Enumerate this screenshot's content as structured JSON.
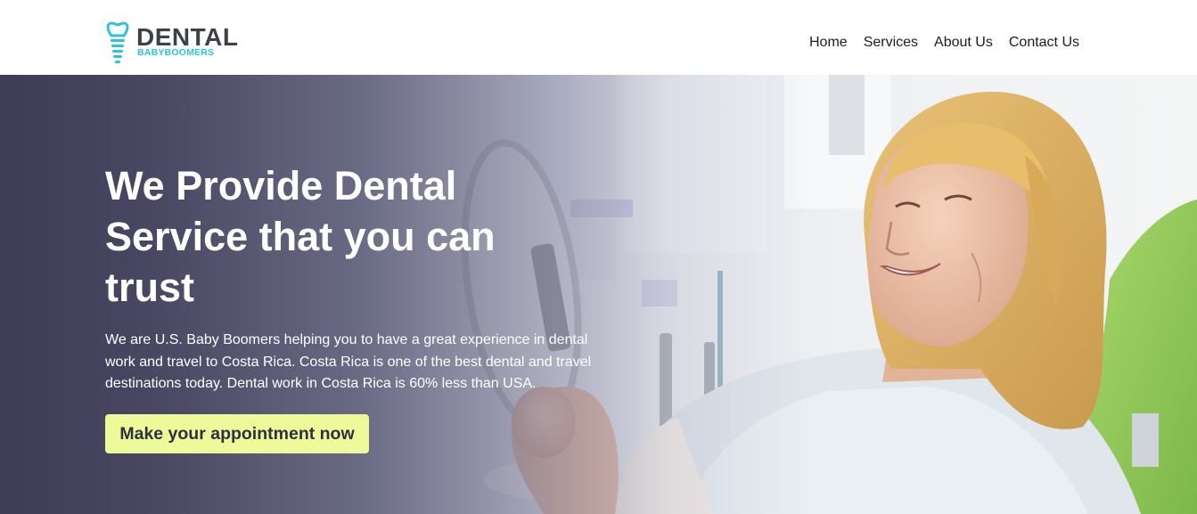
{
  "brand": {
    "name": "DENTAL",
    "subname": "BABYBOOMERS",
    "colors": {
      "dark": "#3e4247",
      "accent": "#2cc3dc"
    }
  },
  "nav": {
    "items": [
      {
        "label": "Home"
      },
      {
        "label": "Services"
      },
      {
        "label": "About Us"
      },
      {
        "label": "Contact Us"
      }
    ]
  },
  "hero": {
    "title": "We Provide Dental Service that you can trust",
    "description": "We are U.S. Baby Boomers helping you to have a great experience in dental work and travel to Costa Rica. Costa Rica is one of the best dental and travel destinations today. Dental work in Costa Rica is 60% less than USA.",
    "cta_label": "Make your appointment now",
    "colors": {
      "overlay": "#3e3c56",
      "cta_bg": "#eefa99",
      "cta_text": "#2e3040"
    }
  },
  "icons": {
    "logo": "tooth-implant-icon"
  }
}
